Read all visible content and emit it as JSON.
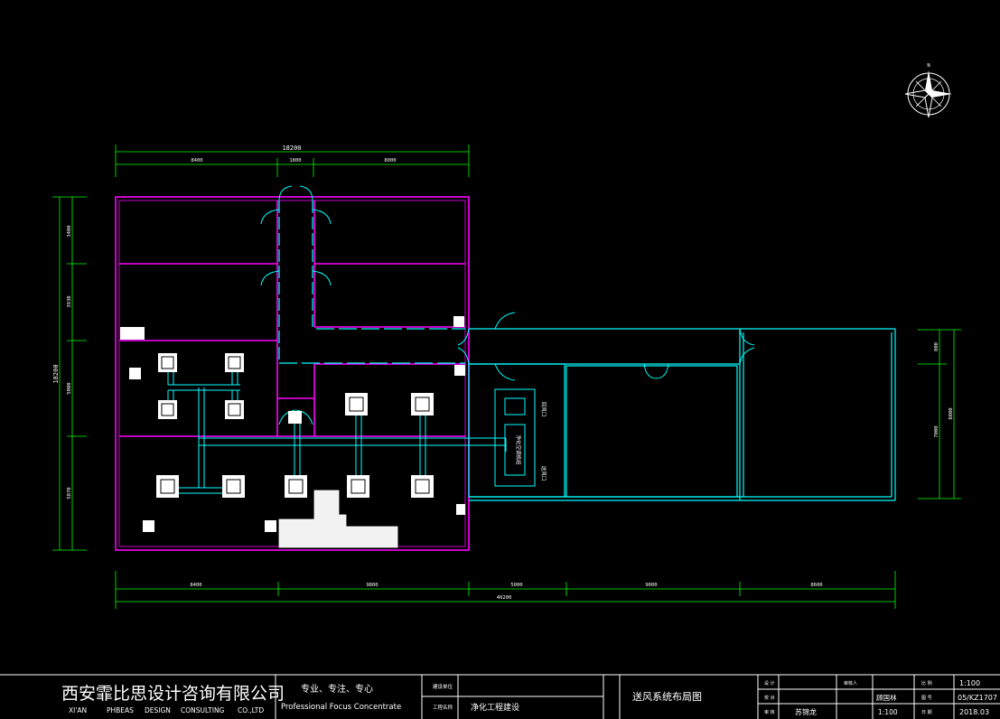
{
  "drawing": {
    "dims_top": {
      "total": "18200",
      "parts": [
        "8400",
        "1800",
        "8000"
      ]
    },
    "dims_bottom": {
      "parts": [
        "8400",
        "9800",
        "5000",
        "9000",
        "8600"
      ],
      "total": "40200"
    },
    "dims_left": {
      "total": "18200",
      "parts": [
        "3400",
        "3930",
        "5000",
        "5870"
      ]
    },
    "dims_right": {
      "total": "8800",
      "parts": [
        "800",
        "7000"
      ]
    },
    "equipment_labels": [
      "净化空调机组",
      "回风口",
      "送风口"
    ],
    "compass_label": "N"
  },
  "title_block": {
    "company_cn": "西安霏比思设计咨询有限公司",
    "company_en": [
      "XI'AN",
      "PHBEAS",
      "DESIGN",
      "CONSULTING",
      "CO.,LTD"
    ],
    "slogan_cn": "专业、专注、专心",
    "slogan_en": "Professional Focus Concentrate",
    "field_labels": [
      "建设单位",
      "工程名称"
    ],
    "project_name": "净化工程建设",
    "drawing_title": "送风系统布局图",
    "sign_labels": [
      "设 计",
      "校 对",
      "审 核"
    ],
    "designer": "苏锦龙",
    "reviewer_label": "审核人",
    "reviewer": "顾国林",
    "scale_label": "比 例",
    "scale": "1:100",
    "scale_2": "1:100",
    "drawing_no_label": "图 号",
    "drawing_no": "05/KZ1707",
    "date_label": "日 期",
    "date": "2018.03"
  }
}
